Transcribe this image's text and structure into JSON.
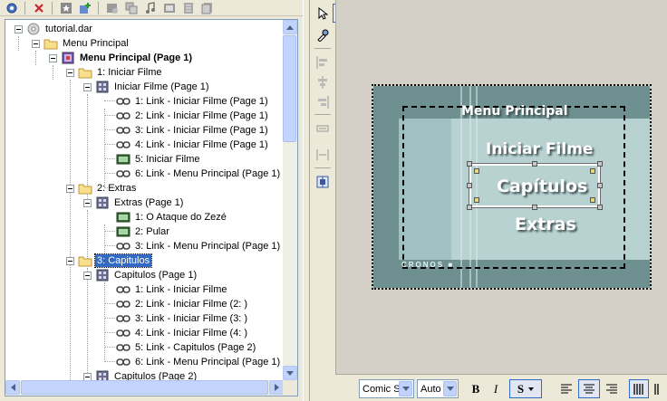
{
  "toolbar": {
    "icons": [
      "settings-icon",
      "delete-icon",
      "star-icon",
      "add-icon",
      "title-icon",
      "copy-icon",
      "music-icon",
      "film-icon",
      "list-icon",
      "pages-icon"
    ]
  },
  "tree": {
    "items": [
      {
        "label": "tutorial.dar",
        "icon": "disc-icon"
      },
      {
        "label": "Menu Principal",
        "icon": "folder-icon"
      },
      {
        "label": "Menu Principal (Page 1)",
        "icon": "menu-page-icon"
      },
      {
        "label": "1: Iniciar Filme",
        "icon": "folder-icon"
      },
      {
        "label": "Iniciar Filme (Page 1)",
        "icon": "page-icon"
      },
      {
        "label": "1: Link - Iniciar Filme (Page 1)",
        "icon": "link-icon"
      },
      {
        "label": "2: Link - Iniciar Filme (Page 1)",
        "icon": "link-icon"
      },
      {
        "label": "3: Link - Iniciar Filme (Page 1)",
        "icon": "link-icon"
      },
      {
        "label": "4: Link - Iniciar Filme (Page 1)",
        "icon": "link-icon"
      },
      {
        "label": "5: Iniciar Filme",
        "icon": "film-icon"
      },
      {
        "label": "6: Link - Menu Principal (Page 1)",
        "icon": "link-icon"
      },
      {
        "label": "2: Extras",
        "icon": "folder-icon"
      },
      {
        "label": "Extras (Page 1)",
        "icon": "page-icon"
      },
      {
        "label": "1: O Ataque do Zezé",
        "icon": "film-icon"
      },
      {
        "label": "2: Pular",
        "icon": "film-icon"
      },
      {
        "label": "3: Link - Menu Principal (Page 1)",
        "icon": "link-icon"
      },
      {
        "label": "3: Capitulos",
        "icon": "folder-icon"
      },
      {
        "label": "Capitulos (Page 1)",
        "icon": "page-icon"
      },
      {
        "label": "1: Link - Iniciar Filme",
        "icon": "link-icon"
      },
      {
        "label": "2: Link - Iniciar Filme (2: )",
        "icon": "link-icon"
      },
      {
        "label": "3: Link - Iniciar Filme (3: )",
        "icon": "link-icon"
      },
      {
        "label": "4: Link - Iniciar Filme (4: )",
        "icon": "link-icon"
      },
      {
        "label": "5: Link - Capitulos (Page 2)",
        "icon": "link-icon"
      },
      {
        "label": "6: Link - Menu Principal (Page 1)",
        "icon": "link-icon"
      },
      {
        "label": "Capitulos (Page 2)",
        "icon": "page-icon"
      }
    ]
  },
  "tools": [
    "pointer-icon",
    "grid-icon",
    "color-picker-icon",
    "align-left-icon",
    "align-top-icon",
    "align-center-h-icon",
    "align-center-v-icon",
    "align-right-icon",
    "align-bottom-icon",
    "same-width-icon",
    "same-height-icon",
    "space-h-icon",
    "space-v-icon",
    "center-h-icon",
    "center-v-icon"
  ],
  "canvas": {
    "menu_title": "Menu Principal",
    "button_1": "Iniciar Filme",
    "button_2": "Capítulos",
    "button_3": "Extras",
    "logo": "CRONOS"
  },
  "format": {
    "font": "Comic S",
    "size": "Auto",
    "bold": "B",
    "italic": "I",
    "shadow": "S"
  }
}
